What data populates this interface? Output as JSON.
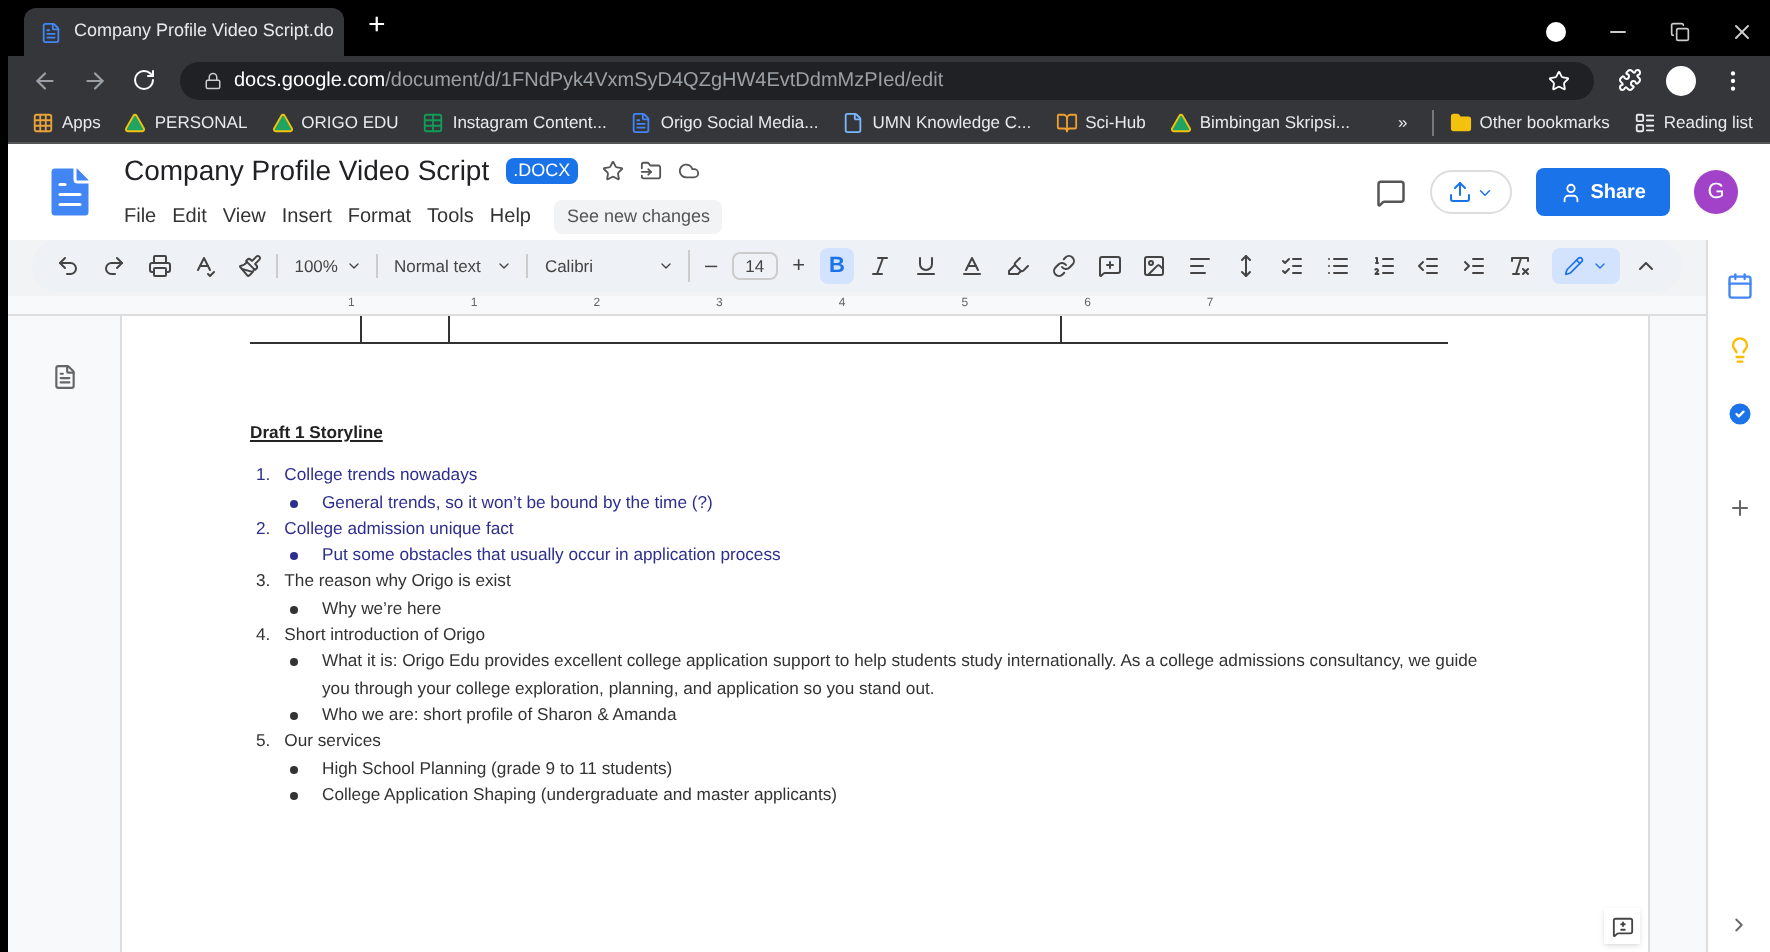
{
  "browser": {
    "tab_title": "Company Profile Video Script.do",
    "new_tab": "+",
    "url_host": "docs.google.com",
    "url_path": "/document/d/1FNdPyk4VxmSyD4QZgHW4EvtDdmMzPIed/edit"
  },
  "bookmarks": [
    {
      "label": "Apps",
      "kind": "apps"
    },
    {
      "label": "PERSONAL",
      "kind": "drive"
    },
    {
      "label": "ORIGO EDU",
      "kind": "drive"
    },
    {
      "label": "Instagram Content...",
      "kind": "sheet"
    },
    {
      "label": "Origo Social Media...",
      "kind": "doc"
    },
    {
      "label": "UMN Knowledge C...",
      "kind": "page"
    },
    {
      "label": "Sci-Hub",
      "kind": "hub"
    },
    {
      "label": "Bimbingan Skripsi...",
      "kind": "drive"
    }
  ],
  "bookmarks_more": "»",
  "other_bookmarks": "Other bookmarks",
  "reading_list": "Reading list",
  "doc": {
    "title": "Company Profile Video Script",
    "badge": ".DOCX",
    "menus": [
      "File",
      "Edit",
      "View",
      "Insert",
      "Format",
      "Tools",
      "Help"
    ],
    "changes": "See new changes",
    "share": "Share",
    "avatar": "G"
  },
  "toolbar": {
    "zoom": "100%",
    "style": "Normal text",
    "font": "Calibri",
    "minus": "–",
    "size": "14",
    "plus": "+",
    "bold_label": "B",
    "bold": true
  },
  "ruler": [
    "1",
    "1",
    "2",
    "3",
    "4",
    "5",
    "6",
    "7"
  ],
  "content": {
    "heading": "Draft 1 Storyline",
    "items": [
      {
        "number": "1.",
        "text": "College trends nowadays",
        "color": "#2e2e8f",
        "children": [
          {
            "text": "General trends, so it won’t be bound by the time (?)"
          }
        ]
      },
      {
        "number": "2.",
        "text": "College admission unique fact",
        "color": "#2e2e8f",
        "children": [
          {
            "text": "Put some obstacles that usually occur in application process"
          }
        ]
      },
      {
        "number": "3.",
        "text": "The reason why Origo is exist",
        "color": "#333333",
        "children": [
          {
            "text": "Why we’re here"
          }
        ]
      },
      {
        "number": "4.",
        "text": "Short introduction of Origo",
        "color": "#333333",
        "children": [
          {
            "text": "What it is: Origo Edu provides excellent college application support to help students study internationally. As a college admissions consultancy, we guide you through your college exploration, planning, and application so you stand out."
          },
          {
            "text": "Who we are: short profile of Sharon & Amanda"
          }
        ]
      },
      {
        "number": "5.",
        "text": "Our services",
        "color": "#333333",
        "children": [
          {
            "text": "High School Planning (grade 9 to 11 students)"
          },
          {
            "text": "College Application Shaping (undergraduate and master applicants)"
          }
        ]
      }
    ]
  }
}
